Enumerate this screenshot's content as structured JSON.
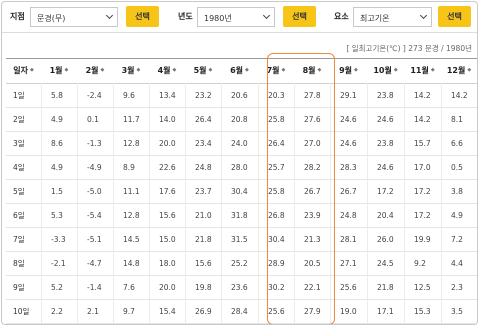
{
  "filters": {
    "station_label": "지점",
    "station_value": "문경(무)",
    "station_button": "선택",
    "year_label": "년도",
    "year_value": "1980년",
    "year_button": "선택",
    "element_label": "요소",
    "element_value": "최고기온",
    "element_button": "선택"
  },
  "unit_note": "[ 일최고기온(℃) ] 273 문경 / 1980년",
  "table": {
    "headers": [
      "일자",
      "1월",
      "2월",
      "3월",
      "4월",
      "5월",
      "6월",
      "7월",
      "8월",
      "9월",
      "10월",
      "11월",
      "12월"
    ],
    "sort_icon": "◆",
    "rows": [
      [
        "1일",
        "5.8",
        "-2.4",
        "9.6",
        "13.4",
        "23.2",
        "20.6",
        "20.3",
        "27.8",
        "29.1",
        "23.8",
        "14.2",
        "14.2"
      ],
      [
        "2일",
        "4.9",
        "0.1",
        "11.7",
        "14.0",
        "26.4",
        "20.8",
        "25.8",
        "27.6",
        "24.6",
        "24.6",
        "14.2",
        "8.1"
      ],
      [
        "3일",
        "8.6",
        "-1.3",
        "12.8",
        "20.0",
        "23.4",
        "24.0",
        "26.4",
        "27.0",
        "24.6",
        "23.8",
        "15.7",
        "6.6"
      ],
      [
        "4일",
        "4.9",
        "-4.9",
        "8.9",
        "22.6",
        "24.8",
        "28.0",
        "25.7",
        "28.2",
        "28.3",
        "24.6",
        "17.0",
        "0.5"
      ],
      [
        "5일",
        "1.5",
        "-5.0",
        "11.1",
        "17.6",
        "23.7",
        "30.4",
        "25.8",
        "26.7",
        "26.7",
        "17.2",
        "17.2",
        "3.8"
      ],
      [
        "6일",
        "5.3",
        "-5.4",
        "12.8",
        "15.6",
        "21.0",
        "31.8",
        "26.8",
        "23.9",
        "24.8",
        "20.4",
        "17.2",
        "4.9"
      ],
      [
        "7일",
        "-3.3",
        "-5.1",
        "14.5",
        "15.0",
        "21.8",
        "31.5",
        "30.4",
        "21.3",
        "28.1",
        "26.0",
        "19.9",
        "7.2"
      ],
      [
        "8일",
        "-2.1",
        "-4.7",
        "14.8",
        "18.0",
        "15.6",
        "25.2",
        "28.9",
        "20.5",
        "27.1",
        "24.5",
        "9.2",
        "4.4"
      ],
      [
        "9일",
        "5.2",
        "-1.4",
        "7.6",
        "20.0",
        "19.8",
        "23.6",
        "30.2",
        "22.1",
        "25.6",
        "21.8",
        "12.5",
        "2.3"
      ],
      [
        "10일",
        "2.2",
        "2.1",
        "9.7",
        "15.4",
        "26.9",
        "28.4",
        "25.6",
        "27.9",
        "19.0",
        "17.1",
        "15.3",
        "3.5"
      ]
    ]
  },
  "colors": {
    "button_yellow": "#f7c518",
    "highlight_orange": "#ef8a3c"
  }
}
